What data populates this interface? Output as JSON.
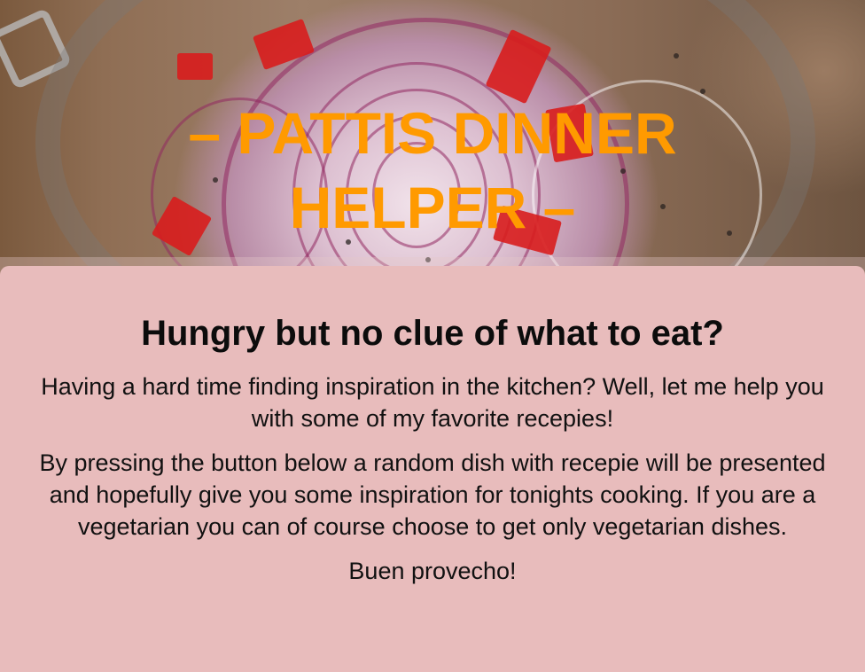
{
  "hero": {
    "title_line1": "– PATTIS DINNER",
    "title_line2": "HELPER –",
    "title_color": "#ff9a00",
    "background_image": "jar-of-pickled-red-onions-photo"
  },
  "intro": {
    "heading": "Hungry but no clue of what to eat?",
    "paragraph1": "Having a hard time finding inspiration in the kitchen? Well, let me help you with some of my favorite recepies!",
    "paragraph2": "By pressing the button below a random dish with recepie will be presented and hopefully give you some inspiration for tonights cooking. If you are a vegetarian you can of course choose to get only vegetarian dishes.",
    "closing": "Buen provecho!",
    "background_color": "#e8bcbc"
  }
}
